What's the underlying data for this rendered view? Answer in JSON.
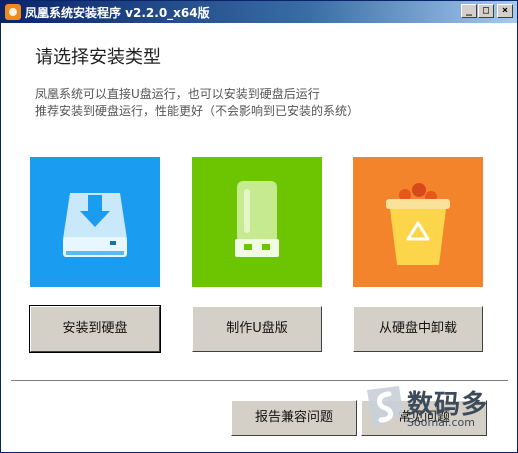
{
  "window": {
    "title": "凤凰系统安装程序 v2.2.0_x64版",
    "controls": {
      "minimize": "_",
      "maximize": "□",
      "close": "×"
    }
  },
  "main": {
    "heading": "请选择安装类型",
    "desc_line1": "凤凰系统可以直接U盘运行，也可以安装到硬盘后运行",
    "desc_line2": "推荐安装到硬盘运行，性能更好（不会影响到已安装的系统）"
  },
  "options": [
    {
      "icon": "hard-drive-download-icon",
      "color": "#1a9cf0",
      "label": "安装到硬盘"
    },
    {
      "icon": "usb-drive-icon",
      "color": "#6dc400",
      "label": "制作U盘版"
    },
    {
      "icon": "recycle-bin-icon",
      "color": "#f3842b",
      "label": "从硬盘中卸载"
    }
  ],
  "footer": {
    "report_label": "报告兼容问题",
    "faq_label": "常见问题"
  },
  "watermark": {
    "text": "数码多",
    "url": "Soomal.com"
  }
}
